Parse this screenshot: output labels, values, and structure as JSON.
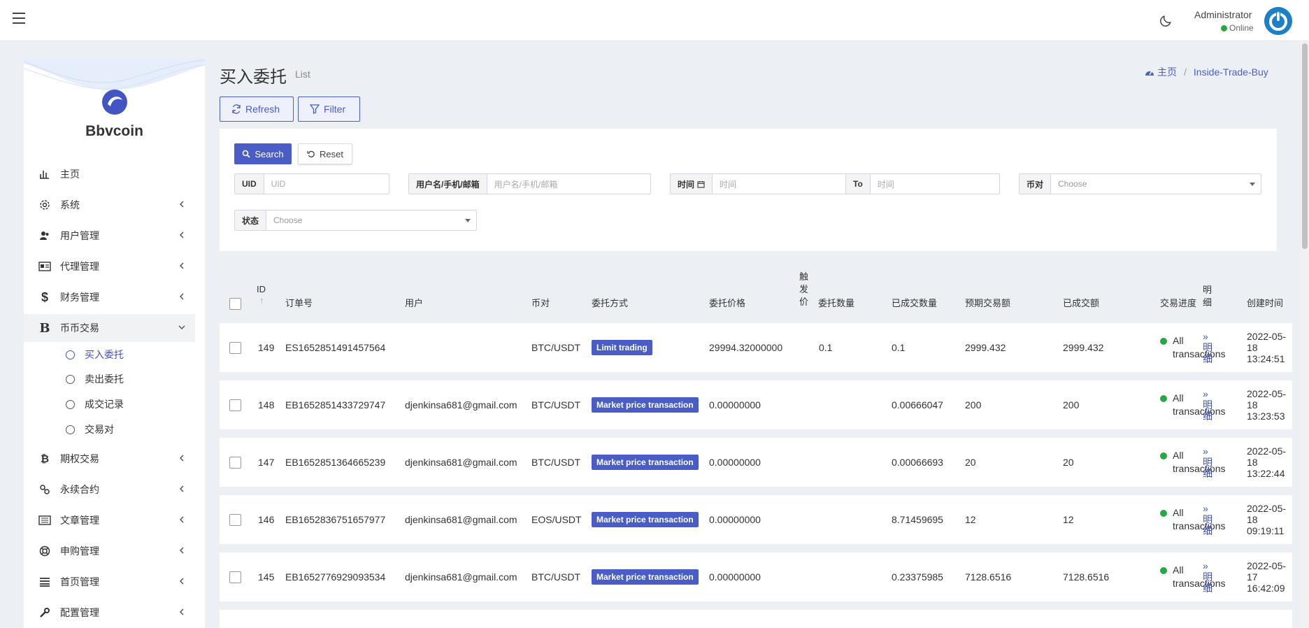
{
  "topbar": {
    "user_name": "Administrator",
    "user_status": "Online"
  },
  "sidebar": {
    "brand": "Bbvcoin",
    "items": [
      {
        "label": "主页",
        "icon": "bar-chart-icon"
      },
      {
        "label": "系统",
        "icon": "gear-icon"
      },
      {
        "label": "用户管理",
        "icon": "users-icon"
      },
      {
        "label": "代理管理",
        "icon": "id-card-icon"
      },
      {
        "label": "财务管理",
        "icon": "dollar-icon"
      },
      {
        "label": "币币交易",
        "icon": "b-icon"
      },
      {
        "label": "期权交易",
        "icon": "bitcoin-icon"
      },
      {
        "label": "永续合约",
        "icon": "link-icon"
      },
      {
        "label": "文章管理",
        "icon": "newspaper-icon"
      },
      {
        "label": "申购管理",
        "icon": "lifebuoy-icon"
      },
      {
        "label": "首页管理",
        "icon": "list-icon"
      },
      {
        "label": "配置管理",
        "icon": "wrench-icon"
      }
    ],
    "subitems": [
      "买入委托",
      "卖出委托",
      "成交记录",
      "交易对"
    ]
  },
  "header": {
    "title": "买入委托",
    "subtitle": "List",
    "breadcrumb_home": "主页",
    "breadcrumb_sep": "/",
    "breadcrumb_current": "Inside-Trade-Buy",
    "refresh_label": "Refresh",
    "filter_label": "Filter"
  },
  "filters": {
    "search_label": "Search",
    "reset_label": "Reset",
    "uid_label": "UID",
    "uid_placeholder": "UID",
    "user_label": "用户名/手机/邮箱",
    "user_placeholder": "用户名/手机/邮箱",
    "time_label": "时间",
    "time_start_placeholder": "时间",
    "time_to": "To",
    "time_end_placeholder": "时间",
    "pair_label": "币对",
    "pair_value": "Choose",
    "status_label": "状态",
    "status_value": "Choose"
  },
  "table": {
    "headers": {
      "id": "ID",
      "order_no": "订单号",
      "user": "用户",
      "pair": "币对",
      "method": "委托方式",
      "price": "委托价格",
      "trigger_price": "触发价",
      "qty": "委托数量",
      "filled_qty": "已成交数量",
      "expected_amount": "预期交易额",
      "filled_amount": "已成交额",
      "progress": "交易进度",
      "detail": "明细",
      "created": "创建时间"
    },
    "rows": [
      {
        "id": "149",
        "order_no": "ES1652851491457564",
        "user": "",
        "pair": "BTC/USDT",
        "method": "Limit trading",
        "price": "29994.32000000",
        "trigger": "",
        "qty": "0.1",
        "filled_qty": "0.1",
        "expected": "2999.432",
        "filled_amount": "2999.432",
        "progress": "All transactions",
        "detail": "明细",
        "created": "2022-05-18 13:24:51"
      },
      {
        "id": "148",
        "order_no": "EB1652851433729747",
        "user": "djenkinsa681@gmail.com",
        "pair": "BTC/USDT",
        "method": "Market price transaction",
        "price": "0.00000000",
        "trigger": "",
        "qty": "",
        "filled_qty": "0.00666047",
        "expected": "200",
        "filled_amount": "200",
        "progress": "All transactions",
        "detail": "明细",
        "created": "2022-05-18 13:23:53"
      },
      {
        "id": "147",
        "order_no": "EB1652851364665239",
        "user": "djenkinsa681@gmail.com",
        "pair": "BTC/USDT",
        "method": "Market price transaction",
        "price": "0.00000000",
        "trigger": "",
        "qty": "",
        "filled_qty": "0.00066693",
        "expected": "20",
        "filled_amount": "20",
        "progress": "All transactions",
        "detail": "明细",
        "created": "2022-05-18 13:22:44"
      },
      {
        "id": "146",
        "order_no": "EB1652836751657977",
        "user": "djenkinsa681@gmail.com",
        "pair": "EOS/USDT",
        "method": "Market price transaction",
        "price": "0.00000000",
        "trigger": "",
        "qty": "",
        "filled_qty": "8.71459695",
        "expected": "12",
        "filled_amount": "12",
        "progress": "All transactions",
        "detail": "明细",
        "created": "2022-05-18 09:19:11"
      },
      {
        "id": "145",
        "order_no": "EB1652776929093534",
        "user": "djenkinsa681@gmail.com",
        "pair": "BTC/USDT",
        "method": "Market price transaction",
        "price": "0.00000000",
        "trigger": "",
        "qty": "",
        "filled_qty": "0.23375985",
        "expected": "7128.6516",
        "filled_amount": "7128.6516",
        "progress": "All transactions",
        "detail": "明细",
        "created": "2022-05-17 16:42:09"
      }
    ]
  }
}
